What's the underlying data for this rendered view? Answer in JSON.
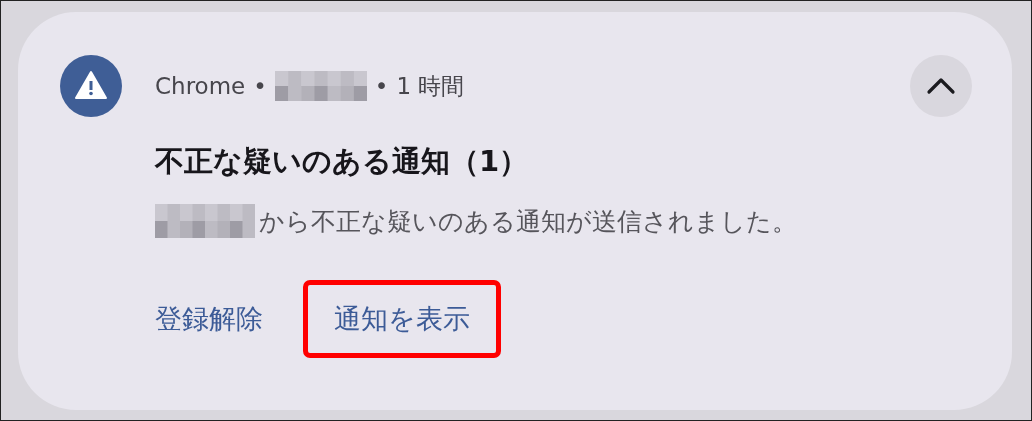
{
  "notification": {
    "app": "Chrome",
    "separator_1": "•",
    "separator_2": "•",
    "time": "1 時間",
    "expanded": true,
    "title": "不正な疑いのある通知（1）",
    "message": "から不正な疑いのある通知が送信されました。",
    "actions": [
      {
        "label": "登録解除",
        "highlighted": false
      },
      {
        "label": "通知を表示",
        "highlighted": true
      }
    ]
  }
}
